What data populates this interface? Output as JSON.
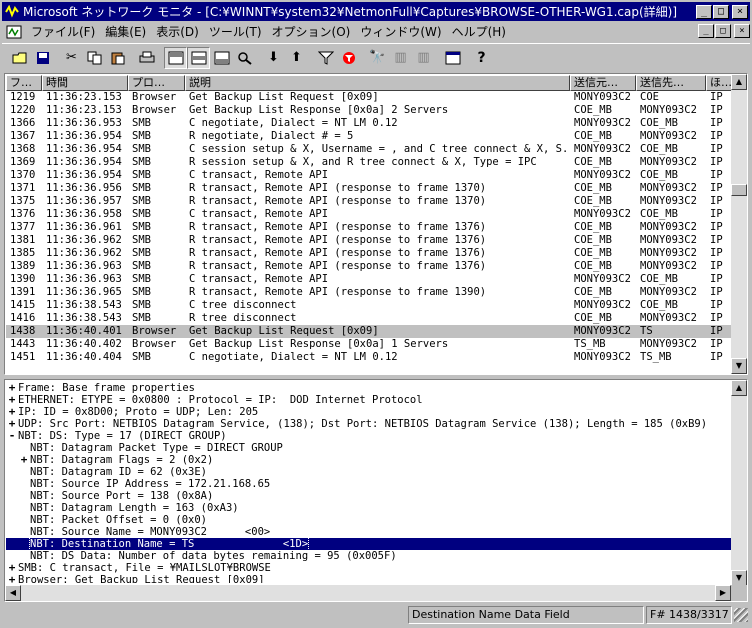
{
  "window": {
    "title": "Microsoft ネットワーク モニタ - [C:¥WINNT¥system32¥NetmonFull¥Captures¥BROWSE-OTHER-WG1.cap(詳細)]",
    "minimize": "_",
    "maximize": "□",
    "close": "×"
  },
  "menu": {
    "items": [
      "ファイル(F)",
      "編集(E)",
      "表示(D)",
      "ツール(T)",
      "オプション(O)",
      "ウィンドウ(W)",
      "ヘルプ(H)"
    ]
  },
  "toolbar": {
    "icons": [
      "open-icon",
      "save-icon",
      "cut-icon",
      "copy-icon",
      "paste-icon",
      "print-icon",
      "pane-summary-icon",
      "pane-detail-icon",
      "pane-hex-icon",
      "zoom-icon",
      "next-frame-icon",
      "prev-frame-icon",
      "filter-icon",
      "display-filter-icon",
      "find-icon",
      "find-next-icon",
      "find-prev-icon",
      "conversation-icon",
      "help-icon"
    ]
  },
  "packet_list": {
    "columns": [
      "フ…",
      "時間",
      "プロ…",
      "説明",
      "送信元…",
      "送信先…",
      "ほ…"
    ],
    "rows": [
      [
        "1219",
        "11:36:23.153",
        "Browser",
        "Get Backup List Request [0x09]",
        "MONY093C2",
        "COE",
        "IP"
      ],
      [
        "1220",
        "11:36:23.153",
        "Browser",
        "Get Backup List Response [0x0a] 2 Servers",
        "COE_MB",
        "MONY093C2",
        "IP"
      ],
      [
        "1366",
        "11:36:36.953",
        "SMB",
        "C negotiate, Dialect = NT LM 0.12",
        "MONY093C2",
        "COE_MB",
        "IP"
      ],
      [
        "1367",
        "11:36:36.954",
        "SMB",
        "R negotiate, Dialect # = 5",
        "COE_MB",
        "MONY093C2",
        "IP"
      ],
      [
        "1368",
        "11:36:36.954",
        "SMB",
        "C session setup & X, Username = , and C tree connect & X, S...",
        "MONY093C2",
        "COE_MB",
        "IP"
      ],
      [
        "1369",
        "11:36:36.954",
        "SMB",
        "R session setup & X, and R tree connect & X, Type = IPC",
        "COE_MB",
        "MONY093C2",
        "IP"
      ],
      [
        "1370",
        "11:36:36.954",
        "SMB",
        "C transact, Remote API",
        "MONY093C2",
        "COE_MB",
        "IP"
      ],
      [
        "1371",
        "11:36:36.956",
        "SMB",
        "R transact, Remote API (response to frame 1370)",
        "COE_MB",
        "MONY093C2",
        "IP"
      ],
      [
        "1375",
        "11:36:36.957",
        "SMB",
        "R transact, Remote API (response to frame 1370)",
        "COE_MB",
        "MONY093C2",
        "IP"
      ],
      [
        "1376",
        "11:36:36.958",
        "SMB",
        "C transact, Remote API",
        "MONY093C2",
        "COE_MB",
        "IP"
      ],
      [
        "1377",
        "11:36:36.961",
        "SMB",
        "R transact, Remote API (response to frame 1376)",
        "COE_MB",
        "MONY093C2",
        "IP"
      ],
      [
        "1381",
        "11:36:36.962",
        "SMB",
        "R transact, Remote API (response to frame 1376)",
        "COE_MB",
        "MONY093C2",
        "IP"
      ],
      [
        "1385",
        "11:36:36.962",
        "SMB",
        "R transact, Remote API (response to frame 1376)",
        "COE_MB",
        "MONY093C2",
        "IP"
      ],
      [
        "1389",
        "11:36:36.963",
        "SMB",
        "R transact, Remote API (response to frame 1376)",
        "COE_MB",
        "MONY093C2",
        "IP"
      ],
      [
        "1390",
        "11:36:36.963",
        "SMB",
        "C transact, Remote API",
        "MONY093C2",
        "COE_MB",
        "IP"
      ],
      [
        "1391",
        "11:36:36.965",
        "SMB",
        "R transact, Remote API (response to frame 1390)",
        "COE_MB",
        "MONY093C2",
        "IP"
      ],
      [
        "1415",
        "11:36:38.543",
        "SMB",
        "C tree disconnect",
        "MONY093C2",
        "COE_MB",
        "IP"
      ],
      [
        "1416",
        "11:36:38.543",
        "SMB",
        "R tree disconnect",
        "COE_MB",
        "MONY093C2",
        "IP"
      ],
      [
        "1438",
        "11:36:40.401",
        "Browser",
        "Get Backup List Request [0x09]",
        "MONY093C2",
        "TS",
        "IP"
      ],
      [
        "1443",
        "11:36:40.402",
        "Browser",
        "Get Backup List Response [0x0a] 1 Servers",
        "TS_MB",
        "MONY093C2",
        "IP"
      ],
      [
        "1451",
        "11:36:40.404",
        "SMB",
        "C negotiate, Dialect = NT LM 0.12",
        "MONY093C2",
        "TS_MB",
        "IP"
      ]
    ],
    "selected_frame": "1438"
  },
  "detail_tree": {
    "lines": [
      {
        "exp": "+",
        "level": 0,
        "text": "Frame: Base frame properties"
      },
      {
        "exp": "+",
        "level": 0,
        "text": "ETHERNET: ETYPE = 0x0800 : Protocol = IP:  DOD Internet Protocol"
      },
      {
        "exp": "+",
        "level": 0,
        "text": "IP: ID = 0x8D00; Proto = UDP; Len: 205"
      },
      {
        "exp": "+",
        "level": 0,
        "text": "UDP: Src Port: NETBIOS Datagram Service, (138); Dst Port: NETBIOS Datagram Service (138); Length = 185 (0xB9)"
      },
      {
        "exp": "-",
        "level": 0,
        "text": "NBT: DS: Type = 17 (DIRECT GROUP)"
      },
      {
        "exp": "",
        "level": 1,
        "text": "NBT: Datagram Packet Type = DIRECT GROUP"
      },
      {
        "exp": "+",
        "level": 1,
        "text": "NBT: Datagram Flags = 2 (0x2)"
      },
      {
        "exp": "",
        "level": 1,
        "text": "NBT: Datagram ID = 62 (0x3E)"
      },
      {
        "exp": "",
        "level": 1,
        "text": "NBT: Source IP Address = 172.21.168.65"
      },
      {
        "exp": "",
        "level": 1,
        "text": "NBT: Source Port = 138 (0x8A)"
      },
      {
        "exp": "",
        "level": 1,
        "text": "NBT: Datagram Length = 163 (0xA3)"
      },
      {
        "exp": "",
        "level": 1,
        "text": "NBT: Packet Offset = 0 (0x0)"
      },
      {
        "exp": "",
        "level": 1,
        "text": "NBT: Source Name = MONY093C2      <00>"
      },
      {
        "exp": "",
        "level": 1,
        "text": "NBT: Destination Name = TS              <1D>",
        "selected": true
      },
      {
        "exp": "",
        "level": 1,
        "text": "NBT: DS Data: Number of data bytes remaining = 95 (0x005F)"
      },
      {
        "exp": "+",
        "level": 0,
        "text": "SMB: C transact, File = ¥MAILSLOT¥BROWSE"
      },
      {
        "exp": "+",
        "level": 0,
        "text": "Browser: Get Backup List Request [0x09]"
      }
    ]
  },
  "status": {
    "field": "Destination Name Data Field",
    "frame": "F# 1438/3317"
  }
}
